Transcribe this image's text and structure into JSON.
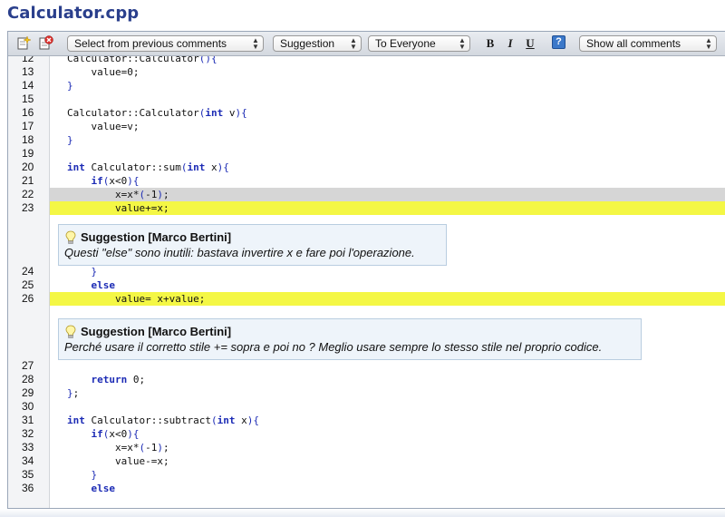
{
  "page": {
    "title": "Calculator.cpp"
  },
  "toolbar": {
    "icons": [
      "new-comment-icon",
      "delete-comment-icon"
    ],
    "previous_comments": "Select from previous comments",
    "comment_type": "Suggestion",
    "audience": "To Everyone",
    "format": {
      "bold": "B",
      "italic": "I",
      "underline": "U"
    },
    "help": "?",
    "view_filter": "Show all comments"
  },
  "code": {
    "lines_a": [
      {
        "n": "12",
        "t": "    Calculator::Calculator(){"
      },
      {
        "n": "13",
        "t": "        value=0;"
      },
      {
        "n": "14",
        "t": "    }"
      },
      {
        "n": "15",
        "t": ""
      },
      {
        "n": "16",
        "t": "    Calculator::Calculator(int v){"
      },
      {
        "n": "17",
        "t": "        value=v;"
      },
      {
        "n": "18",
        "t": "    }"
      },
      {
        "n": "19",
        "t": ""
      },
      {
        "n": "20",
        "t": "    int Calculator::sum(int x){"
      },
      {
        "n": "21",
        "t": "        if(x<0){"
      },
      {
        "n": "22",
        "t": "            x=x*(-1);"
      },
      {
        "n": "23",
        "t": "            value+=x;"
      }
    ],
    "lines_b": [
      {
        "n": "24",
        "t": "        }"
      },
      {
        "n": "25",
        "t": "        else"
      },
      {
        "n": "26",
        "t": "            value= x+value;"
      }
    ],
    "lines_c": [
      {
        "n": "27",
        "t": ""
      },
      {
        "n": "28",
        "t": "        return 0;"
      },
      {
        "n": "29",
        "t": "    };"
      },
      {
        "n": "30",
        "t": ""
      },
      {
        "n": "31",
        "t": "    int Calculator::subtract(int x){"
      },
      {
        "n": "32",
        "t": "        if(x<0){"
      },
      {
        "n": "33",
        "t": "            x=x*(-1);"
      },
      {
        "n": "34",
        "t": "            value-=x;"
      },
      {
        "n": "35",
        "t": "        }"
      },
      {
        "n": "36",
        "t": "        else"
      }
    ]
  },
  "comments": [
    {
      "heading": "Suggestion [Marco Bertini]",
      "text": "Questi \"else\" sono inutili: bastava invertire x e fare poi l'operazione."
    },
    {
      "heading": "Suggestion [Marco Bertini]",
      "text": "Perché usare il corretto stile += sopra e poi no ? Meglio usare sempre lo stesso stile nel proprio codice."
    }
  ]
}
